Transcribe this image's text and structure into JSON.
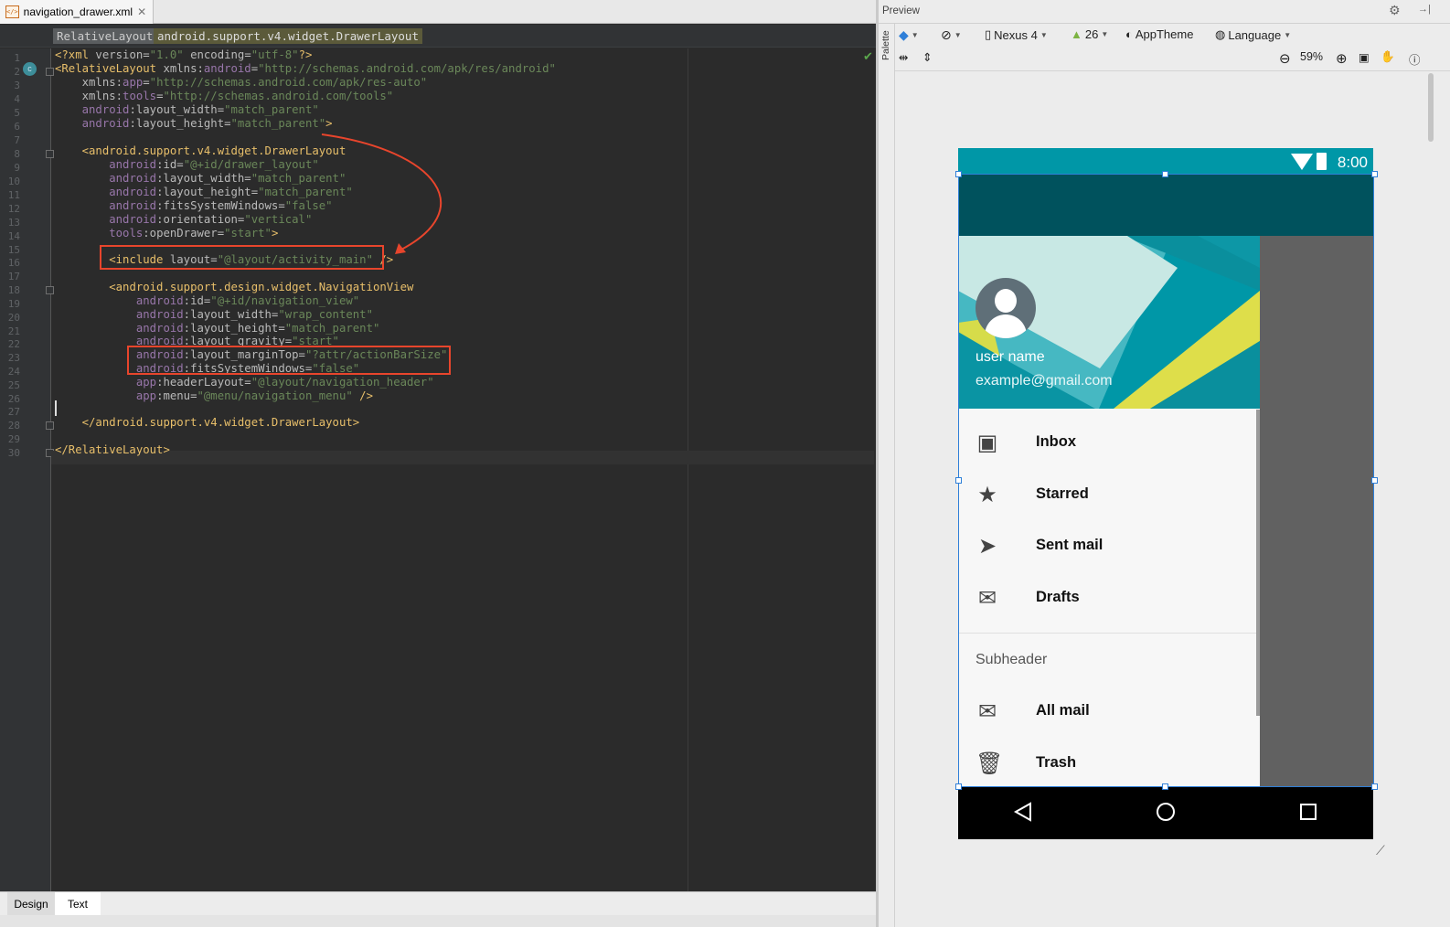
{
  "editor": {
    "file_tab": "navigation_drawer.xml",
    "breadcrumbs": [
      "RelativeLayout",
      "android.support.v4.widget.DrawerLayout"
    ],
    "line_numbers": [
      "1",
      "2",
      "3",
      "4",
      "5",
      "6",
      "7",
      "8",
      "9",
      "10",
      "11",
      "12",
      "13",
      "14",
      "15",
      "16",
      "17",
      "18",
      "19",
      "20",
      "21",
      "22",
      "23",
      "24",
      "25",
      "26",
      "27",
      "28",
      "29",
      "30"
    ],
    "bottom_tabs": [
      "Design",
      "Text"
    ],
    "active_bottom_tab": "Text"
  },
  "preview": {
    "title": "Preview",
    "palette_label": "Palette",
    "device": "Nexus 4",
    "api_level": "26",
    "theme": "AppTheme",
    "language": "Language",
    "zoom": "59%",
    "status_time": "8:00",
    "header": {
      "name": "user name",
      "email": "example@gmail.com"
    },
    "menu_items": [
      {
        "label": "Inbox",
        "icon": "inbox-icon"
      },
      {
        "label": "Starred",
        "icon": "star-icon"
      },
      {
        "label": "Sent mail",
        "icon": "send-icon"
      },
      {
        "label": "Drafts",
        "icon": "drafts-icon"
      }
    ],
    "subheader": "Subheader",
    "sub_items": [
      {
        "label": "All mail",
        "icon": "mail-icon"
      },
      {
        "label": "Trash",
        "icon": "trash-icon"
      }
    ]
  },
  "colors": {
    "statusbar": "#0097a7",
    "appbar": "#00525d",
    "highlight": "#e8452c",
    "selection": "#2f7fd8"
  }
}
